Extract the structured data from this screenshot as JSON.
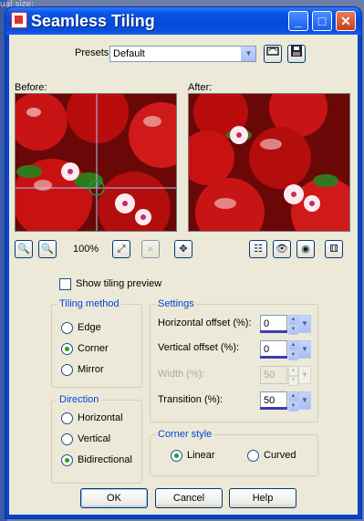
{
  "background": {
    "text": "ual size:"
  },
  "window": {
    "title": "Seamless Tiling"
  },
  "presets": {
    "label": "Presets:",
    "value": "Default"
  },
  "previews": {
    "before_label": "Before:",
    "after_label": "After:"
  },
  "zoom": {
    "level": "100%"
  },
  "show_tiling_preview": {
    "label": "Show tiling preview",
    "checked": false
  },
  "tiling_method": {
    "title": "Tiling method",
    "options": [
      "Edge",
      "Corner",
      "Mirror"
    ],
    "selected": "Corner"
  },
  "direction": {
    "title": "Direction",
    "options": [
      "Horizontal",
      "Vertical",
      "Bidirectional"
    ],
    "selected": "Bidirectional"
  },
  "settings": {
    "title": "Settings",
    "horizontal_offset": {
      "label": "Horizontal offset (%):",
      "value": "0"
    },
    "vertical_offset": {
      "label": "Vertical offset (%):",
      "value": "0"
    },
    "width": {
      "label": "Width (%):",
      "value": "50"
    },
    "transition": {
      "label": "Transition (%):",
      "value": "50"
    }
  },
  "corner_style": {
    "title": "Corner style",
    "options": [
      "Linear",
      "Curved"
    ],
    "selected": "Linear"
  },
  "buttons": {
    "ok": "OK",
    "cancel": "Cancel",
    "help": "Help"
  },
  "colors": {
    "titlebar": "#0a57e6",
    "dialog_bg": "#ece9d8",
    "group_title": "#0046d5",
    "radio_dot": "#21a121"
  }
}
